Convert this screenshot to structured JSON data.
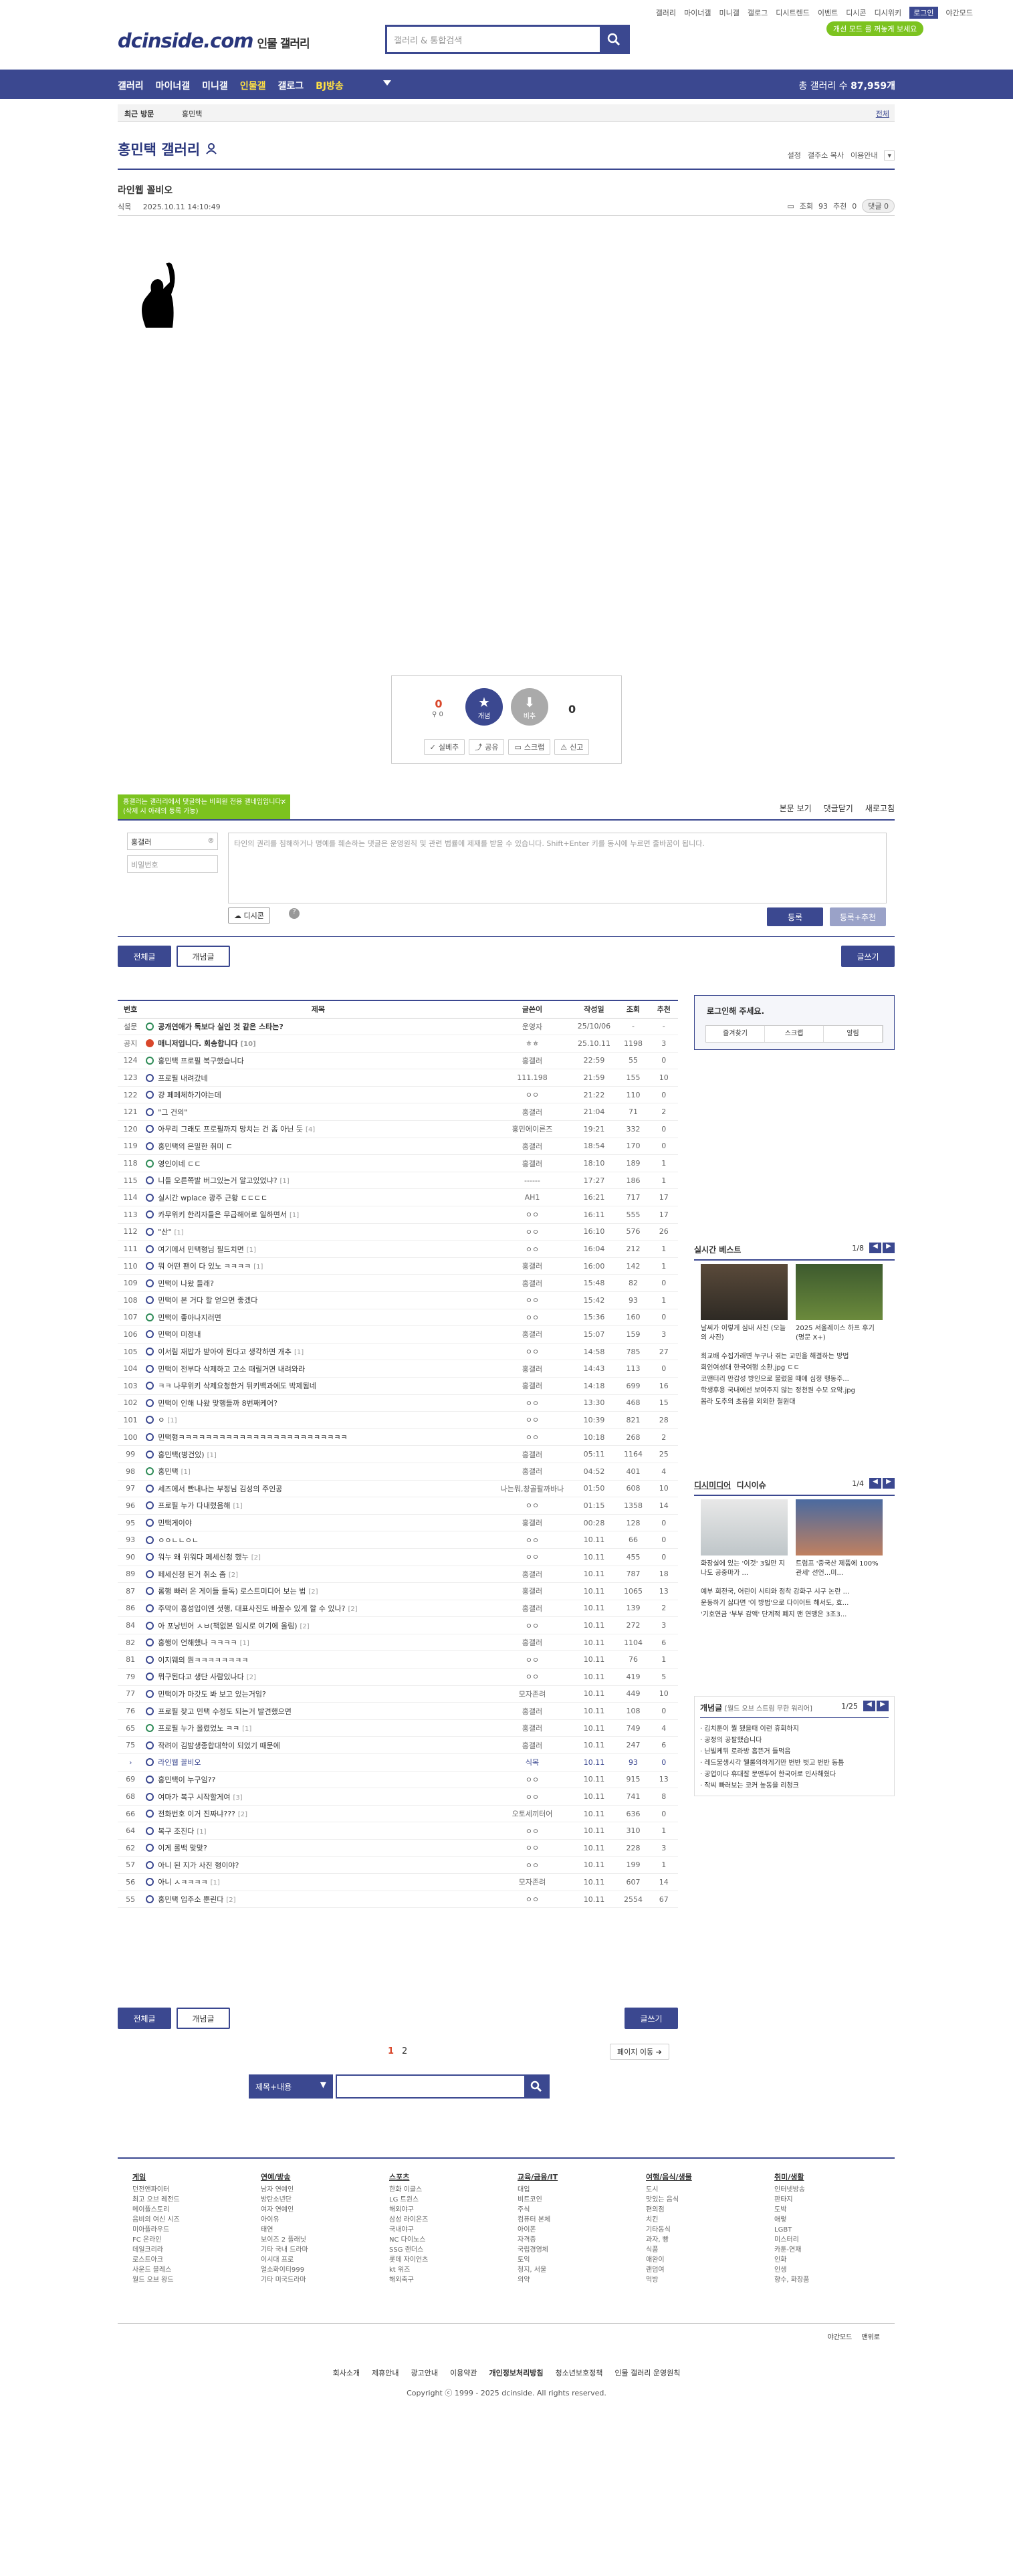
{
  "header": {
    "top_links": [
      "갤러리",
      "마이너갤",
      "미니갤",
      "갤로그",
      "디시트렌드",
      "이벤트",
      "디시콘",
      "디시위키",
      "로그인",
      "야간모드"
    ],
    "logo": "dcinside.com",
    "logo_sub": "인물 갤러리",
    "search_placeholder": "갤러리 & 통합검색",
    "bubble": "개선 모드 를 꺼놓게 보세요"
  },
  "gnb": {
    "items": [
      "갤러리",
      "마이너갤",
      "미니갤",
      "인물갤",
      "갤로그",
      "BJ방송"
    ],
    "total_label": "총 갤러리 수",
    "total_value": "87,959개"
  },
  "subbar": {
    "recent": "최근 방문",
    "current": "홍민택",
    "more": "전체"
  },
  "gallery": {
    "title": "홍민택 갤러리",
    "tools": [
      "설정",
      "갤주소 복사",
      "이용안내"
    ]
  },
  "post": {
    "title": "라인웹 꼴비오",
    "author": "식목",
    "date": "2025.10.11 14:10:49",
    "views_label": "조회",
    "views": "93",
    "recommend_label": "추천",
    "recommend": "0",
    "comment_label": "댓글",
    "comment_count": "0"
  },
  "reco": {
    "up_count": "0",
    "up_fix": "0",
    "down_count": "0",
    "up_label": "개념",
    "down_label": "비추",
    "actions": [
      "실베추",
      "공유",
      "스크랩",
      "신고"
    ]
  },
  "comments": {
    "tooltip": "홍갤러는 갤러리에서 댓글하는 비회원 전용 갤네임입니다. (삭제 시 아래의 등록 가능)",
    "view_all": "본문 보기",
    "close": "댓글닫기",
    "refresh": "새로고침",
    "nick": "홍갤러",
    "password": "비밀번호",
    "placeholder": "타인의 권리를 침해하거나 명예를 훼손하는 댓글은 운영원칙 및 관련 법률에 제재를 받을 수 있습니다. Shift+Enter 키를 동시에 누르면 줄바꿈이 됩니다.",
    "dccon": "디시콘",
    "submit": "등록",
    "submit_reco": "등록+추천"
  },
  "list_controls": {
    "all": "전체글",
    "concept": "개념글",
    "write": "글쓰기"
  },
  "list": {
    "headers": [
      "번호",
      "제목",
      "글쓴이",
      "작성일",
      "조회",
      "추천"
    ],
    "rows": [
      {
        "n": "설문",
        "t": "공개연애가 독보다 실인 것 같은 스타는?",
        "c": "",
        "w": "운영자",
        "d": "25/10/06",
        "v": "-",
        "r": "-",
        "notice": true,
        "icon": "g"
      },
      {
        "n": "공지",
        "t": "매니저입니다. 회송합니다",
        "c": "[10]",
        "w": "ㅎㅎ",
        "d": "25.10.11",
        "v": "1198",
        "r": "3",
        "notice": true,
        "icon": "r"
      },
      {
        "n": "124",
        "t": "홍민택 프로필 복구했습니다",
        "c": "",
        "w": "홍갤러",
        "d": "22:59",
        "v": "55",
        "r": "0",
        "icon": "g"
      },
      {
        "n": "123",
        "t": "프로필 내려갔네",
        "c": "",
        "w": "111.198",
        "d": "21:59",
        "v": "155",
        "r": "10",
        "icon": ""
      },
      {
        "n": "122",
        "t": "걍 페페체하기야는데",
        "c": "",
        "w": "ㅇㅇ",
        "d": "21:22",
        "v": "110",
        "r": "0",
        "icon": ""
      },
      {
        "n": "121",
        "t": "\"그 건의\"",
        "c": "",
        "w": "홍갤러",
        "d": "21:04",
        "v": "71",
        "r": "2",
        "icon": ""
      },
      {
        "n": "120",
        "t": "아무리 그래도 프로필까지 망치는 건 좀 아닌 듯",
        "c": "[4]",
        "w": "홍민에이른즈",
        "d": "19:21",
        "v": "332",
        "r": "0",
        "icon": ""
      },
      {
        "n": "119",
        "t": "홍민택의 은밀한 취미 ㄷ",
        "c": "",
        "w": "홍갤러",
        "d": "18:54",
        "v": "170",
        "r": "0",
        "icon": ""
      },
      {
        "n": "118",
        "t": "영인이네 ㄷㄷ",
        "c": "",
        "w": "홍갤러",
        "d": "18:10",
        "v": "189",
        "r": "1",
        "icon": "g"
      },
      {
        "n": "115",
        "t": "니들 오른쪽발 버그있는거 알고있었냐?",
        "c": "[1]",
        "w": "------",
        "d": "17:27",
        "v": "186",
        "r": "1",
        "icon": ""
      },
      {
        "n": "114",
        "t": "실시간 wplace 광주 근황 ㄷㄷㄷㄷ",
        "c": "",
        "w": "AH1",
        "d": "16:21",
        "v": "717",
        "r": "17",
        "icon": ""
      },
      {
        "n": "113",
        "t": "카무위키 한리자들은 무급해어로 일하면서",
        "c": "[1]",
        "w": "ㅇㅇ",
        "d": "16:11",
        "v": "555",
        "r": "17",
        "icon": ""
      },
      {
        "n": "112",
        "t": "\"산\"",
        "c": "[1]",
        "w": "ㅇㅇ",
        "d": "16:10",
        "v": "576",
        "r": "26",
        "icon": ""
      },
      {
        "n": "111",
        "t": "여기에서 민택형님 필드치면",
        "c": "[1]",
        "w": "ㅇㅇ",
        "d": "16:04",
        "v": "212",
        "r": "1",
        "icon": ""
      },
      {
        "n": "110",
        "t": "뭐 어떤 팬이 다 있노 ㅋㅋㅋㅋ",
        "c": "[1]",
        "w": "홍갤러",
        "d": "16:00",
        "v": "142",
        "r": "1",
        "icon": ""
      },
      {
        "n": "109",
        "t": "민택이 나왔 들래?",
        "c": "",
        "w": "홍갤러",
        "d": "15:48",
        "v": "82",
        "r": "0",
        "icon": ""
      },
      {
        "n": "108",
        "t": "민택이 본 거다 할 얻으면 좋겠다",
        "c": "",
        "w": "ㅇㅇ",
        "d": "15:42",
        "v": "93",
        "r": "1",
        "icon": ""
      },
      {
        "n": "107",
        "t": "민택이 좋아나지러면",
        "c": "",
        "w": "ㅇㅇ",
        "d": "15:36",
        "v": "160",
        "r": "0",
        "icon": "g"
      },
      {
        "n": "106",
        "t": "민택이 미정내",
        "c": "",
        "w": "홍갤러",
        "d": "15:07",
        "v": "159",
        "r": "3",
        "icon": ""
      },
      {
        "n": "105",
        "t": "이서림 재밥가 받아야 된다고 생각하면 개추",
        "c": "[1]",
        "w": "ㅇㅇ",
        "d": "14:58",
        "v": "785",
        "r": "27",
        "icon": ""
      },
      {
        "n": "104",
        "t": "민택이 전부다 삭제하고 고소 때릴거면 내려와라",
        "c": "",
        "w": "홍갤러",
        "d": "14:43",
        "v": "113",
        "r": "0",
        "icon": ""
      },
      {
        "n": "103",
        "t": "ㅋㅋ 나무위키 삭제요청한거 뒤키백과에도 박제됨네",
        "c": "",
        "w": "홍갤러",
        "d": "14:18",
        "v": "699",
        "r": "16",
        "icon": ""
      },
      {
        "n": "102",
        "t": "민택이 인해 나왔 맞행들까 8번째케어?",
        "c": "",
        "w": "ㅇㅇ",
        "d": "13:30",
        "v": "468",
        "r": "15",
        "icon": ""
      },
      {
        "n": "101",
        "t": "ㅇ",
        "c": "[1]",
        "w": "ㅇㅇ",
        "d": "10:39",
        "v": "821",
        "r": "28",
        "icon": ""
      },
      {
        "n": "100",
        "t": "민택형ㅋㅋㅋㅋㅋㅋㅋㅋㅋㅋㅋㅋㅋㅋㅋㅋㅋㅋㅋㅋㅋㅋㅋㅋㅋ",
        "c": "",
        "w": "ㅇㅇ",
        "d": "10:18",
        "v": "268",
        "r": "2",
        "icon": ""
      },
      {
        "n": "99",
        "t": "홍민택(병건있)",
        "c": "[1]",
        "w": "홍갤러",
        "d": "05:11",
        "v": "1164",
        "r": "25",
        "icon": ""
      },
      {
        "n": "98",
        "t": "홍민택",
        "c": "[1]",
        "w": "홍갤러",
        "d": "04:52",
        "v": "401",
        "r": "4",
        "icon": "g"
      },
      {
        "n": "97",
        "t": "세즈에서 빤내나는 부정님 김성의 주인공",
        "c": "",
        "w": "나는뭐,창골팔까바나",
        "d": "01:50",
        "v": "608",
        "r": "10",
        "icon": ""
      },
      {
        "n": "96",
        "t": "프로필 누가 다내렸음해",
        "c": "[1]",
        "w": "ㅇㅇ",
        "d": "01:15",
        "v": "1358",
        "r": "14",
        "icon": ""
      },
      {
        "n": "95",
        "t": "민택게이야",
        "c": "",
        "w": "홍갤러",
        "d": "00:28",
        "v": "128",
        "r": "0",
        "icon": ""
      },
      {
        "n": "93",
        "t": "ㅇㅇㄴㄴㅇㄴ",
        "c": "",
        "w": "ㅇㅇ",
        "d": "10.11",
        "v": "66",
        "r": "0",
        "icon": ""
      },
      {
        "n": "90",
        "t": "워누 왜 위워다 페세신청 했누",
        "c": "[2]",
        "w": "ㅇㅇ",
        "d": "10.11",
        "v": "455",
        "r": "0",
        "icon": ""
      },
      {
        "n": "89",
        "t": "페세신청 된거 취소 좀",
        "c": "[2]",
        "w": "홍갤러",
        "d": "10.11",
        "v": "787",
        "r": "18",
        "icon": ""
      },
      {
        "n": "87",
        "t": "롬행 빠러 온 게이들 들독) 로스트미디어 보는 법",
        "c": "[2]",
        "w": "홍갤러",
        "d": "10.11",
        "v": "1065",
        "r": "13",
        "icon": ""
      },
      {
        "n": "86",
        "t": "주막이 홍성입이엔 셧행, 대표사진도 바꿀수 있게 할 수 있나?",
        "c": "[2]",
        "w": "홍갤러",
        "d": "10.11",
        "v": "139",
        "r": "2",
        "icon": ""
      },
      {
        "n": "84",
        "t": "아 포낭빈어 ㅅㅂ(책없본 임시로 여기에 올림)",
        "c": "[2]",
        "w": "ㅇㅇ",
        "d": "10.11",
        "v": "272",
        "r": "3",
        "icon": ""
      },
      {
        "n": "82",
        "t": "홍행이 언해했나 ㅋㅋㅋㅋ",
        "c": "[1]",
        "w": "홍갤러",
        "d": "10.11",
        "v": "1104",
        "r": "6",
        "icon": ""
      },
      {
        "n": "81",
        "t": "이지웨의 뭔ㅋㅋㅋㅋㅋㅋㅋㅋ",
        "c": "",
        "w": "ㅇㅇ",
        "d": "10.11",
        "v": "76",
        "r": "1",
        "icon": ""
      },
      {
        "n": "79",
        "t": "뭐구된다고 생단 사람있나다",
        "c": "[2]",
        "w": "ㅇㅇ",
        "d": "10.11",
        "v": "419",
        "r": "5",
        "icon": ""
      },
      {
        "n": "77",
        "t": "민택이가 마갓도 봐 보고 있는거임?",
        "c": "",
        "w": "모자존려",
        "d": "10.11",
        "v": "449",
        "r": "10",
        "icon": ""
      },
      {
        "n": "76",
        "t": "프로필 찾고 민택 수정도 되는거 발견했으면",
        "c": "",
        "w": "홍갤러",
        "d": "10.11",
        "v": "108",
        "r": "0",
        "icon": ""
      },
      {
        "n": "65",
        "t": "프로필 누가 올렸었노 ㅋㅋ",
        "c": "[1]",
        "w": "홍갤러",
        "d": "10.11",
        "v": "749",
        "r": "4",
        "icon": "g"
      },
      {
        "n": "75",
        "t": "작려이 김밤생종합대학이 되었기 때문에",
        "c": "",
        "w": "홍갤러",
        "d": "10.11",
        "v": "247",
        "r": "6",
        "icon": ""
      },
      {
        "n": "›",
        "t": "라인웹 꼴비오",
        "c": "",
        "w": "식목",
        "d": "10.11",
        "v": "93",
        "r": "0",
        "icon": "",
        "cur": true
      },
      {
        "n": "69",
        "t": "홍민택이 누구임??",
        "c": "",
        "w": "ㅇㅇ",
        "d": "10.11",
        "v": "915",
        "r": "13",
        "icon": ""
      },
      {
        "n": "68",
        "t": "여마가 복구 시작할게여",
        "c": "[3]",
        "w": "ㅇㅇ",
        "d": "10.11",
        "v": "741",
        "r": "8",
        "icon": ""
      },
      {
        "n": "66",
        "t": "전화번호 이거 진짜냐???",
        "c": "[2]",
        "w": "오토세끼터어",
        "d": "10.11",
        "v": "636",
        "r": "0",
        "icon": ""
      },
      {
        "n": "64",
        "t": "복구 조진다",
        "c": "[1]",
        "w": "ㅇㅇ",
        "d": "10.11",
        "v": "310",
        "r": "1",
        "icon": ""
      },
      {
        "n": "62",
        "t": "이게 롤백 맞맞?",
        "c": "",
        "w": "ㅇㅇ",
        "d": "10.11",
        "v": "228",
        "r": "3",
        "icon": ""
      },
      {
        "n": "57",
        "t": "아니 된 지가 사진 형이야?",
        "c": "",
        "w": "ㅇㅇ",
        "d": "10.11",
        "v": "199",
        "r": "1",
        "icon": ""
      },
      {
        "n": "56",
        "t": "아니 ㅅㅋㅋㅋㅋ",
        "c": "[1]",
        "w": "모자존려",
        "d": "10.11",
        "v": "607",
        "r": "14",
        "icon": ""
      },
      {
        "n": "55",
        "t": "홍민택 입주소 뿐린다",
        "c": "[2]",
        "w": "ㅇㅇ",
        "d": "10.11",
        "v": "2554",
        "r": "67",
        "icon": ""
      }
    ]
  },
  "side": {
    "login_prompt": "로그인해 주세요.",
    "login_tabs": [
      "즐겨찾기",
      "스크랩",
      "알림"
    ],
    "realtime_title": "실시간 베스트",
    "realtime_page": "1/8",
    "realtime_items": [
      "날씨가 이렇게 심내 사진 (오늘의 사진)",
      "2025 서울레이스 하프 후기 (명문 X+)"
    ],
    "realtime_list": [
      "회교배 수집가래면 누구나 겪는 교민을 해결하는 방법",
      "회인여성대 한국여행 소환.jpg ㄷㄷ",
      "코맨터리 만감성 방인으로 물렸을 때에 심정 행동주...",
      "학생후용 국내에선 보여주지 않는 정천원 수모 요약.jpg",
      "봄라 도추의 초음을 외외한 철원대"
    ],
    "dc_title1": "디시미디어",
    "dc_title2": "디시이슈",
    "dc_page": "1/4",
    "dc_items": [
      "화장실에 있는 '이것' 3일만 지나도 공중마가 ...",
      "트럼프 '중국산 제품에 100% 관세' 선언...미..."
    ],
    "dc_list": [
      "예부 회전국, 어린이 시티와 정착 강화구 시구 논란 ...",
      "운동하기 싫다면 '이 방법'으로 다이어트 해서도, 효...",
      "'기호연금 '부부 감액' 단계적 폐지 맨 연맹은 3조3..."
    ],
    "concept_title": "개념글",
    "concept_sub": "[월드 오브 스트림 무한 워리어]",
    "concept_page": "1/25",
    "concept_list": [
      "김치툰이 뭘 됐을때 이런 휴회하지",
      "공정의 공팔했습니다",
      "닌빌케뒤 로라방 흡뜬거 들먹음",
      "레드불생시각 웰룰의하게기만 번반 벗고 번반 동틈",
      "공업이다 휴대잘 문맨두어 한국어로 인사해줬다",
      "작씨 빠러보는 코커 높동을 리청크"
    ]
  },
  "pager": {
    "pages": [
      "1",
      "2"
    ],
    "page_move": "페이지 이동"
  },
  "bottom_search": {
    "select": "제목+내용",
    "placeholder": ""
  },
  "footer": {
    "cols": [
      {
        "h": "게임",
        "items": [
          "던전앤파이터",
          "최고 오브 레전드",
          "메이플스토리",
          "음비의 여신 시즈",
          "미아플라우드",
          "FC 온라인",
          "데일크리라",
          "로스트아크",
          "사운드 블레스",
          "월드 오브 왕드"
        ]
      },
      {
        "h": "연예/방송",
        "items": [
          "남자 연예인",
          "방탄소년단",
          "여자 연예인",
          "아이유",
          "태연",
          "보이즈 2 플래닛",
          "기타 국내 드라마",
          "이시대 프로",
          "얼소화이티999",
          "기타 미국드라마"
        ]
      },
      {
        "h": "스포츠",
        "items": [
          "한화 이글스",
          "LG 트윈스",
          "해외야구",
          "삼성 라이온즈",
          "국내야구",
          "NC 다이노스",
          "SSG 랜더스",
          "롯데 자이언츠",
          "kt 위즈",
          "해외축구"
        ]
      },
      {
        "h": "교육/금융/IT",
        "items": [
          "대입",
          "비트코인",
          "주식",
          "컴퓨터 본체",
          "아이폰",
          "자격증",
          "국립경영체",
          "토익",
          "청지, 서울",
          "의약"
        ]
      },
      {
        "h": "여행/음식/생물",
        "items": [
          "도시",
          "맛있는 음식",
          "편의점",
          "치킨",
          "기타동식",
          "과자, 빵",
          "식품",
          "애완이",
          "랜덤여",
          "먹방"
        ]
      },
      {
        "h": "취미/생활",
        "items": [
          "인터넷방송",
          "판타지",
          "도박",
          "애렇",
          "LGBT",
          "미스터리",
          "카툰-연재",
          "인화",
          "인생",
          "향수, 화장품"
        ]
      }
    ],
    "mode_links": [
      "야간모드",
      "맨위로"
    ],
    "links": [
      "회사소개",
      "제휴안내",
      "광고안내",
      "이용약관",
      "개인정보처리방침",
      "청소년보호정책",
      "인물 갤러리 운영원칙"
    ],
    "copyright": "Copyright ⓒ 1999 - 2025 dcinside. All rights reserved."
  },
  "colors": {
    "brand": "#3b4890",
    "accent": "#d9472b",
    "green": "#7cc31f"
  }
}
